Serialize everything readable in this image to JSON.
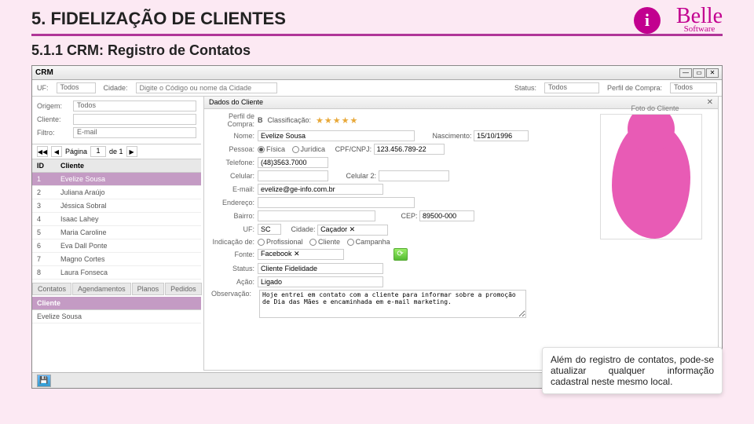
{
  "header": {
    "title": "5. FIDELIZAÇÃO DE CLIENTES",
    "subtitle": "5.1.1 CRM: Registro de Contatos",
    "logo_main": "Belle",
    "logo_sub": "Software"
  },
  "window": {
    "title": "CRM",
    "filters": {
      "uf_label": "UF:",
      "uf_value": "Todos",
      "cidade_label": "Cidade:",
      "cidade_placeholder": "Digite o Código ou nome da Cidade",
      "status_label": "Status:",
      "status_value": "Todos",
      "perfil_label": "Perfil de Compra:",
      "perfil_value": "Todos"
    },
    "left": {
      "origem_label": "Origem:",
      "origem_value": "Todos",
      "cliente_label": "Cliente:",
      "filtro_label": "Filtro:",
      "filtro_value": "E-mail",
      "pager": {
        "prev": "◀◀",
        "prev1": "◀",
        "page_label": "Página",
        "page": "1",
        "of": "de 1",
        "next1": "▶"
      },
      "columns": {
        "id": "ID",
        "cliente": "Cliente"
      },
      "rows": [
        {
          "id": "1",
          "name": "Evelize Sousa",
          "selected": true
        },
        {
          "id": "2",
          "name": "Juliana Araújo"
        },
        {
          "id": "3",
          "name": "Jéssica Sobral"
        },
        {
          "id": "4",
          "name": "Isaac Lahey"
        },
        {
          "id": "5",
          "name": "Maria Caroline"
        },
        {
          "id": "6",
          "name": "Eva Dall Ponte"
        },
        {
          "id": "7",
          "name": "Magno Cortes"
        },
        {
          "id": "8",
          "name": "Laura Fonseca"
        }
      ],
      "tabs": [
        "Contatos",
        "Agendamentos",
        "Planos",
        "Pedidos"
      ],
      "sub_col": "Cliente",
      "sub_rows": [
        "Evelize Sousa"
      ]
    },
    "panel": {
      "title": "Dados do Cliente",
      "photo_caption": "Foto do Cliente",
      "perfil_label": "Perfil de Compra:",
      "classificacao_label": "Classificação:",
      "classificacao_letter": "B",
      "nome_label": "Nome:",
      "nome_value": "Evelize Sousa",
      "nasc_label": "Nascimento:",
      "nasc_value": "15/10/1996",
      "pessoa_label": "Pessoa:",
      "pessoa_fisica": "Física",
      "pessoa_juridica": "Jurídica",
      "cpf_label": "CPF/CNPJ:",
      "cpf_value": "123.456.789-22",
      "tel_label": "Telefone:",
      "tel_value": "(48)3563.7000",
      "cel_label": "Celular:",
      "cel2_label": "Celular 2:",
      "email_label": "E-mail:",
      "email_value": "evelize@ge-info.com.br",
      "endereco_label": "Endereço:",
      "bairro_label": "Bairro:",
      "cep_label": "CEP:",
      "cep_value": "89500-000",
      "uf_label": "UF:",
      "uf_value": "SC",
      "cidade_label": "Cidade:",
      "cidade_value": "Caçador ✕",
      "indicacao_label": "Indicação de:",
      "ind_prof": "Profissional",
      "ind_cli": "Cliente",
      "ind_camp": "Campanha",
      "fonte_label": "Fonte:",
      "fonte_value": "Facebook ✕",
      "status_label": "Status:",
      "status_value": "Cliente Fidelidade",
      "acao_label": "Ação:",
      "acao_value": "Ligado",
      "obs_label": "Observação:",
      "obs_value": "Hoje entrei em contato com a cliente para informar sobre a promoção de Dia das Mães e encaminhada em e-mail marketing."
    }
  },
  "tooltip": "Além do registro de contatos, pode-se atualizar qualquer informação cadastral neste mesmo local."
}
